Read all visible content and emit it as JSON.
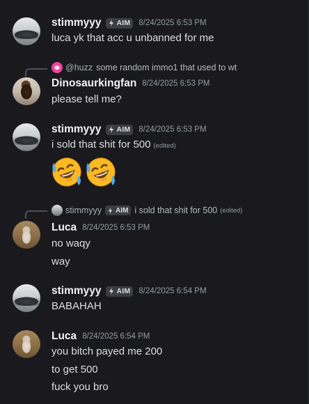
{
  "colors": {
    "background": "#1a1a1e",
    "username": "#f2f3f5",
    "text": "#dbdee1",
    "timestamp": "#949ba4",
    "tag_bg": "#3c3d44",
    "reply_icon": "#eb459e"
  },
  "messages": [
    {
      "author": "stimmyyy",
      "tag": "AIM",
      "timestamp": "8/24/2025 6:53 PM",
      "avatar_icon": "car-avatar",
      "lines": [
        "luca yk that acc u unbanned for me"
      ]
    },
    {
      "reply": {
        "author": "@huzz",
        "text": "some random immo1 that used to wt",
        "icon": "discord-icon"
      },
      "author": "Dinosaurkingfan",
      "timestamp": "8/24/2025 6:53 PM",
      "avatar_icon": "dino-avatar",
      "lines": [
        "please tell me?"
      ]
    },
    {
      "author": "stimmyyy",
      "tag": "AIM",
      "timestamp": "8/24/2025 6:53 PM",
      "avatar_icon": "car-avatar",
      "lines": [
        "i sold that shit for 500"
      ],
      "edited": "(edited)",
      "emojis": [
        "rolling-on-floor-laughing-emoji",
        "rolling-on-floor-laughing-emoji"
      ]
    },
    {
      "reply": {
        "author": "stimmyyy",
        "tag": "AIM",
        "text": "i sold that shit for 500",
        "edited": "(edited)"
      },
      "author": "Luca",
      "timestamp": "8/24/2025 6:53 PM",
      "avatar_icon": "cat-avatar",
      "lines": [
        "no waqy",
        "way"
      ]
    },
    {
      "author": "stimmyyy",
      "tag": "AIM",
      "timestamp": "8/24/2025 6:54 PM",
      "avatar_icon": "car-avatar",
      "lines": [
        "BABAHAH"
      ]
    },
    {
      "author": "Luca",
      "timestamp": "8/24/2025 6:54 PM",
      "avatar_icon": "cat-avatar",
      "lines": [
        "you bitch payed me 200",
        "to get 500",
        "fuck you bro"
      ]
    }
  ]
}
